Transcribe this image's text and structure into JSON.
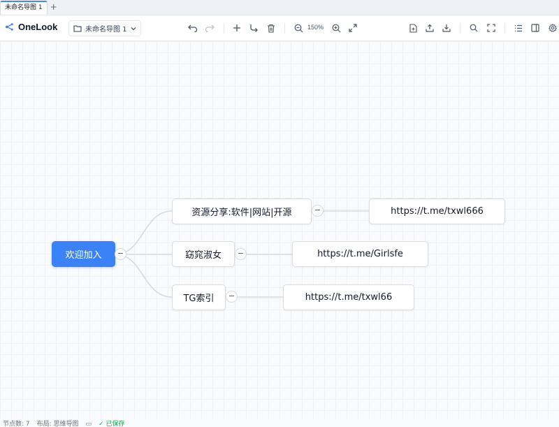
{
  "tabs": [
    {
      "label": "未命名导图 1"
    }
  ],
  "tab_add_label": "+",
  "app": {
    "name": "OneLook"
  },
  "toolbar": {
    "file_name": "未命名导图 1",
    "zoom_level": "150%"
  },
  "icons": {
    "logo": "mindmap-logo-icon",
    "folder": "folder-icon",
    "undo": "undo-icon",
    "redo": "redo-icon",
    "add": "plus-icon",
    "add_child": "add-child-icon",
    "delete": "trash-icon",
    "zoom_out": "zoom-out-icon",
    "zoom_in": "zoom-in-icon",
    "fit": "fit-screen-icon",
    "new": "new-file-icon",
    "export": "upload-icon",
    "import": "download-icon",
    "search": "search-icon",
    "fullscreen": "fullscreen-icon",
    "outline": "outline-list-icon",
    "sidebar": "sidebar-toggle-icon",
    "settings": "gear-icon"
  },
  "colors": {
    "accent": "#3b82f6",
    "status_ok": "#16a34a"
  },
  "mindmap": {
    "root": {
      "label": "欢迎加入"
    },
    "children": [
      {
        "label": "资源分享:软件|网站|开源",
        "child": {
          "label": "https://t.me/txwl666"
        }
      },
      {
        "label": "窈窕淑女",
        "child": {
          "label": "https://t.me/Girlsfe"
        }
      },
      {
        "label": "TG索引",
        "child": {
          "label": "https://t.me/txwl66"
        }
      }
    ],
    "collapse_label": "−"
  },
  "statusbar": {
    "nodes": "节点数: 7",
    "layout": "布局: 思维导图",
    "saved": "✓ 已保存"
  }
}
